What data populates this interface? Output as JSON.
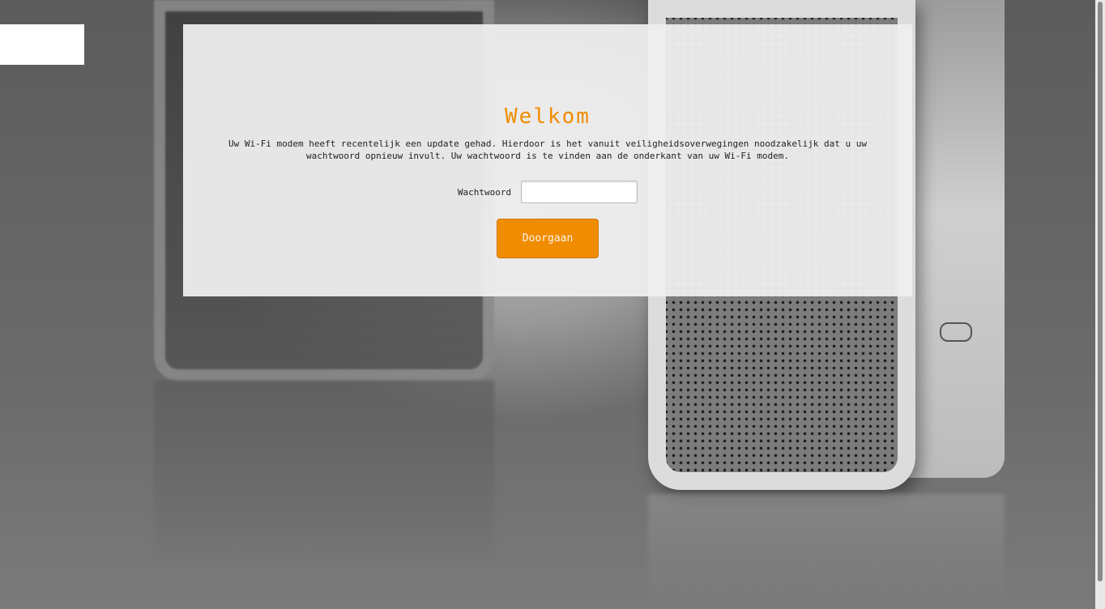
{
  "panel": {
    "title": "Welkom",
    "message": "Uw Wi-Fi modem heeft recentelijk een update gehad. Hierdoor is het vanuit veiligheidsoverwegingen noodzakelijk dat u uw wachtwoord opnieuw invult. Uw wachtwoord is te vinden aan de onderkant van uw Wi-Fi modem.",
    "password_label": "Wachtwoord",
    "password_value": "",
    "submit_label": "Doorgaan"
  },
  "colors": {
    "accent": "#f08c00",
    "panel_background": "#eeeeee"
  }
}
